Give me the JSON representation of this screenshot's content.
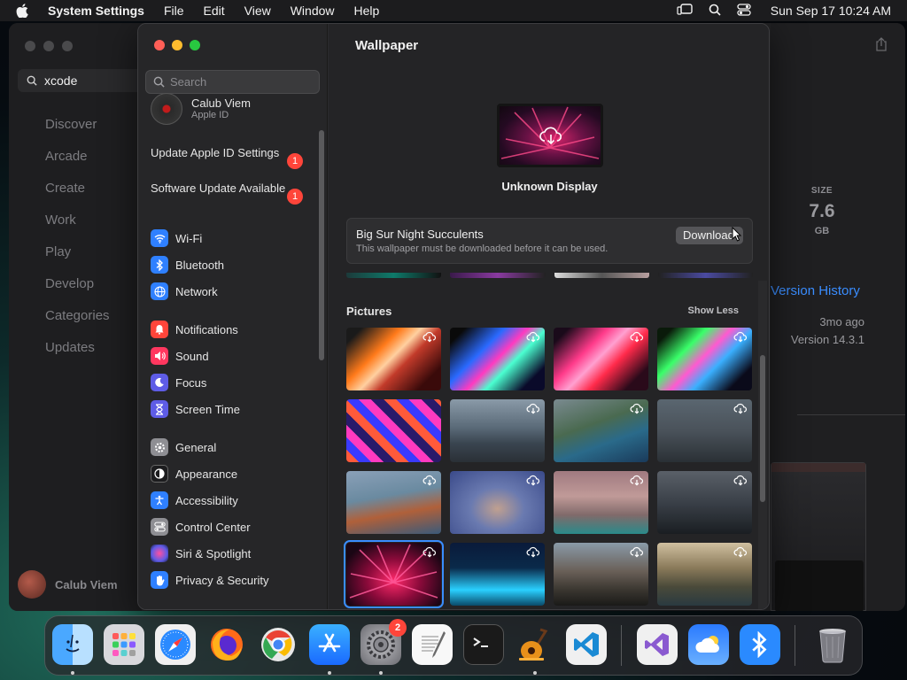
{
  "menubar": {
    "app": "System Settings",
    "items": [
      "File",
      "Edit",
      "View",
      "Window",
      "Help"
    ],
    "clock": "Sun Sep 17  10:24 AM"
  },
  "appstore": {
    "search_value": "xcode",
    "nav": [
      "Discover",
      "Arcade",
      "Create",
      "Work",
      "Play",
      "Develop",
      "Categories",
      "Updates"
    ],
    "user": "Calub Viem",
    "size_label": "SIZE",
    "size_value": "7.6",
    "size_unit": "GB",
    "version_history": "Version History",
    "updated_ago": "3mo ago",
    "version": "Version 14.3.1"
  },
  "settings": {
    "search_placeholder": "Search",
    "profile": {
      "name": "Calub Viem",
      "sub": "Apple ID"
    },
    "alerts": [
      {
        "label": "Update Apple ID Settings",
        "badge": "1"
      },
      {
        "label": "Software Update Available",
        "badge": "1"
      }
    ],
    "groups": [
      [
        {
          "label": "Wi-Fi",
          "icon": "wifi-icon",
          "color": "#2f80ff"
        },
        {
          "label": "Bluetooth",
          "icon": "bluetooth-icon",
          "color": "#2f80ff"
        },
        {
          "label": "Network",
          "icon": "globe-icon",
          "color": "#2f80ff"
        }
      ],
      [
        {
          "label": "Notifications",
          "icon": "bell-icon",
          "color": "#ff453a"
        },
        {
          "label": "Sound",
          "icon": "speaker-icon",
          "color": "#ff375f"
        },
        {
          "label": "Focus",
          "icon": "moon-icon",
          "color": "#5e5ce6"
        },
        {
          "label": "Screen Time",
          "icon": "hourglass-icon",
          "color": "#5e5ce6"
        }
      ],
      [
        {
          "label": "General",
          "icon": "gear-icon",
          "color": "#8e8e93"
        },
        {
          "label": "Appearance",
          "icon": "appearance-icon",
          "color": "#1c1c1e"
        },
        {
          "label": "Accessibility",
          "icon": "accessibility-icon",
          "color": "#2f80ff"
        },
        {
          "label": "Control Center",
          "icon": "toggles-icon",
          "color": "#8e8e93"
        },
        {
          "label": "Siri & Spotlight",
          "icon": "siri-icon",
          "color": "#bf5af2"
        },
        {
          "label": "Privacy & Security",
          "icon": "hand-icon",
          "color": "#2f80ff"
        }
      ]
    ],
    "main": {
      "title": "Wallpaper",
      "display_label": "Unknown Display",
      "wallpaper_name": "Big Sur Night Succulents",
      "wallpaper_note": "This wallpaper must be downloaded before it can be used.",
      "download_label": "Download",
      "section_title": "Pictures",
      "show_less": "Show Less"
    }
  },
  "dock": {
    "software_update_badge": "2"
  }
}
